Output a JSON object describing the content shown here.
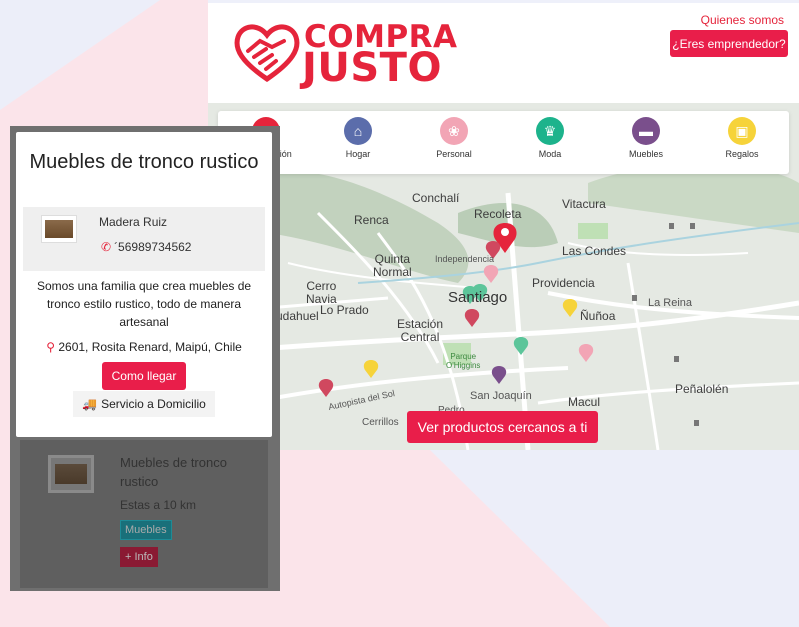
{
  "header": {
    "logo_line1": "COMPRA",
    "logo_line2": "JUSTO",
    "nav_link": "Quienes somos",
    "entrepreneur_button": "¿Eres emprendedor?"
  },
  "categories": [
    {
      "label": "Alimentación",
      "icon": "cake-icon",
      "color": "#e5243b"
    },
    {
      "label": "Hogar",
      "icon": "home-icon",
      "color": "#5b6dab"
    },
    {
      "label": "Personal",
      "icon": "lotus-icon",
      "color": "#f2a5b5"
    },
    {
      "label": "Moda",
      "icon": "crown-icon",
      "color": "#1db38c"
    },
    {
      "label": "Muebles",
      "icon": "bed-icon",
      "color": "#7a4f8c"
    },
    {
      "label": "Regalos",
      "icon": "gift-icon",
      "color": "#f6d33a"
    }
  ],
  "map": {
    "labels": {
      "renca_top": "Renca",
      "conchali": "Conchalí",
      "recoleta": "Recoleta",
      "vitacura": "Vitacura",
      "renca": "Renca",
      "independencia": "Independencia",
      "las_condes": "Las Condes",
      "quinta_normal": "Quinta\nNormal",
      "cerro_navia": "Cerro\nNavia",
      "santiago": "Santiago",
      "providencia": "Providencia",
      "lo_prado": "Lo Prado",
      "la_reina": "La Reina",
      "pudahuel": "udahuel",
      "estacion_central": "Estación\nCentral",
      "nunoa": "Ñuñoa",
      "parque": "Parque\nO'Higgins",
      "san_joaquin": "San Joaquín",
      "penalolen": "Peñalolén",
      "autopista": "Autopista del Sol",
      "macul": "Macul",
      "cerrillos": "Cerrillos",
      "pedro": "Pedro"
    },
    "nearby_button": "Ver productos cercanos a ti"
  },
  "popup": {
    "title": "Muebles de tronco rustico",
    "vendor_name": "Madera Ruiz",
    "vendor_phone": "´56989734562",
    "description": "Somos una familia que crea muebles de tronco estilo rustico, todo de manera artesanal",
    "address": "2601, Rosita Renard, Maipú, Chile",
    "directions_button": "Como llegar",
    "delivery_label": "Servicio a Domicilio"
  },
  "list_item": {
    "title": "Muebles de tronco rustico",
    "distance": "Estas a 10 km",
    "tag": "Muebles",
    "info_button": "+ Info"
  }
}
